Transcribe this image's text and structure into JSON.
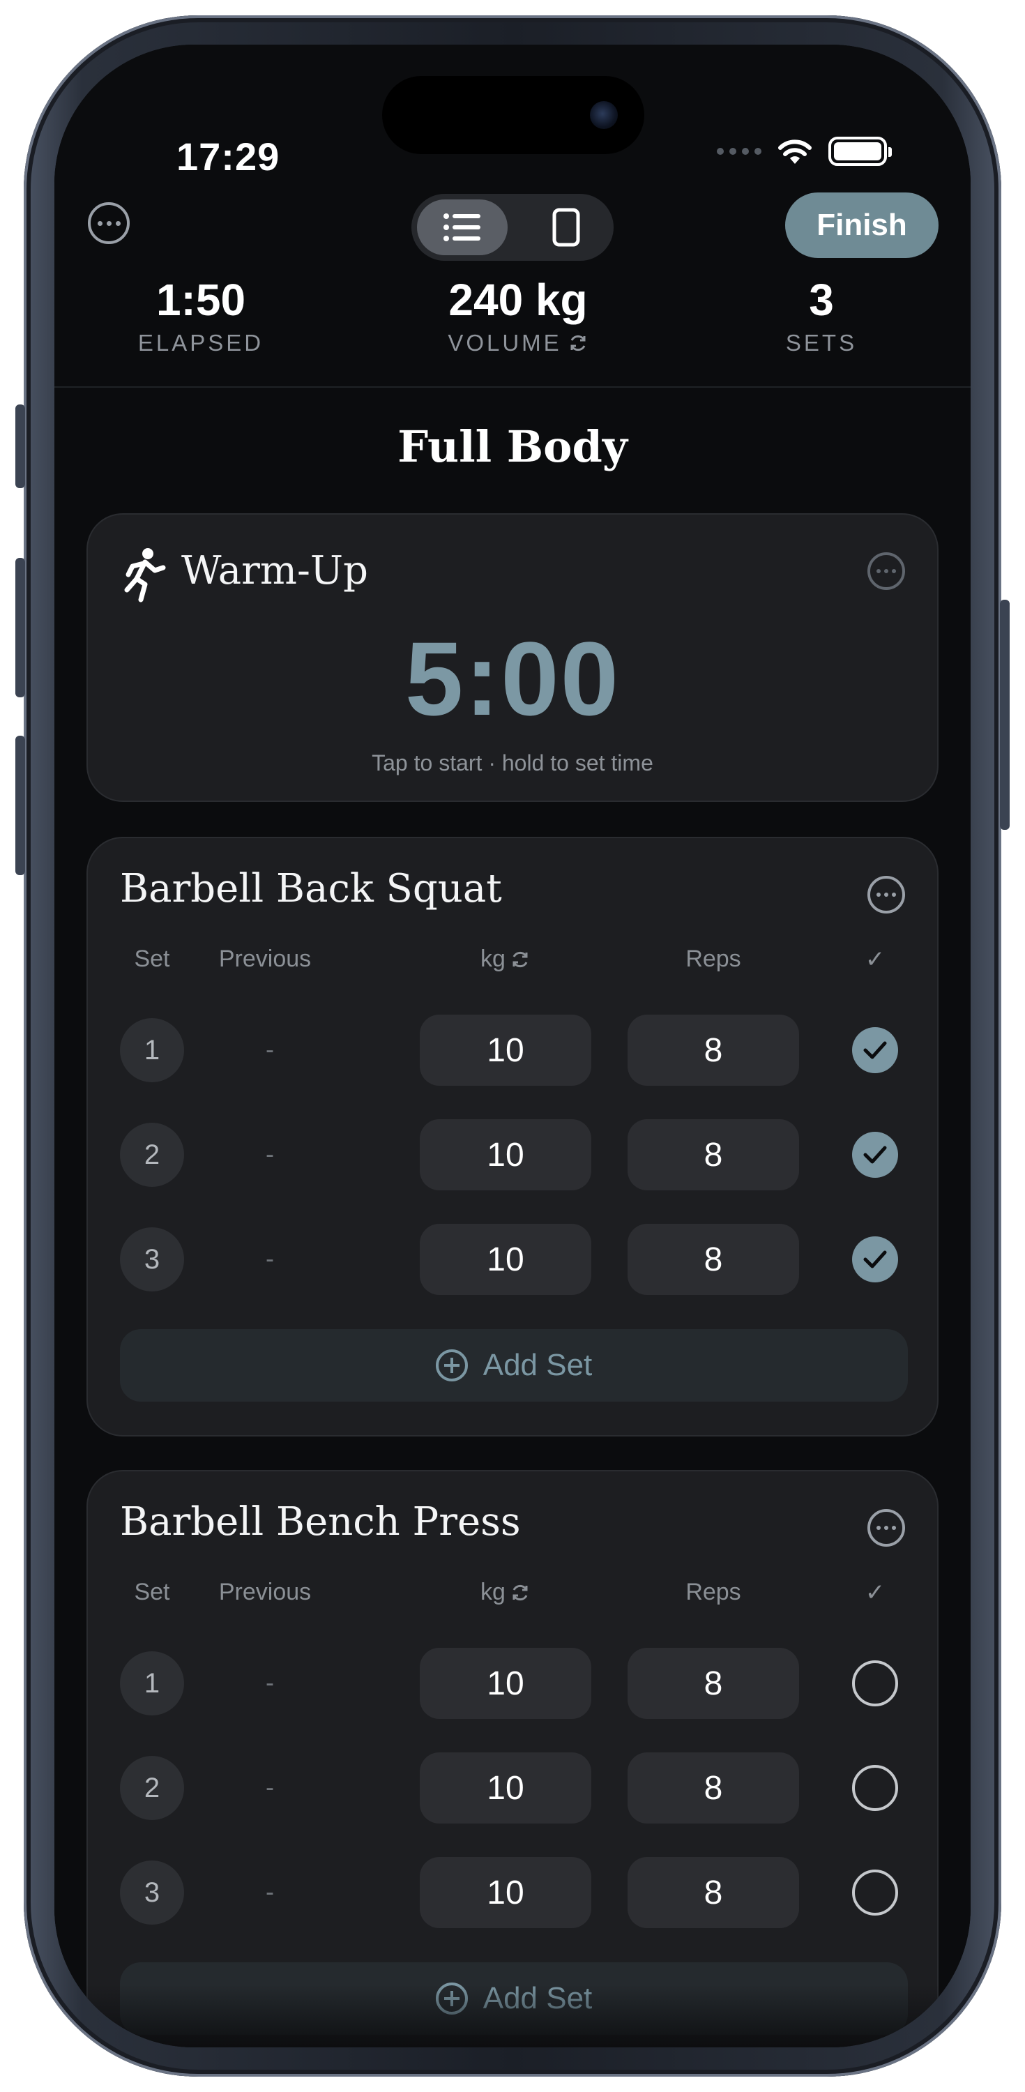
{
  "status_bar": {
    "time": "17:29"
  },
  "header": {
    "more_icon": "ellipsis-circle-icon",
    "view_toggle": {
      "list_icon": "list-icon",
      "card_icon": "card-icon",
      "selected": "list"
    },
    "finish_label": "Finish",
    "accent_color": "#6f8b95"
  },
  "stats": {
    "elapsed": {
      "value": "1:50",
      "label": "ELAPSED"
    },
    "volume": {
      "value": "240 kg",
      "label": "VOLUME"
    },
    "sets": {
      "value": "3",
      "label": "SETS"
    }
  },
  "workout": {
    "title": "Full Body"
  },
  "warmup": {
    "title": "Warm-Up",
    "timer": "5:00",
    "hint": "Tap to start · hold to set time",
    "icon": "running-figure-icon"
  },
  "columns": {
    "set": "Set",
    "previous": "Previous",
    "weight": "kg",
    "reps": "Reps",
    "check": "✓"
  },
  "exercises": [
    {
      "name": "Barbell Back Squat",
      "add_set_label": "Add Set",
      "sets": [
        {
          "number": "1",
          "previous": "-",
          "weight": "10",
          "reps": "8",
          "completed": true
        },
        {
          "number": "2",
          "previous": "-",
          "weight": "10",
          "reps": "8",
          "completed": true
        },
        {
          "number": "3",
          "previous": "-",
          "weight": "10",
          "reps": "8",
          "completed": true
        }
      ]
    },
    {
      "name": "Barbell Bench Press",
      "add_set_label": "Add Set",
      "sets": [
        {
          "number": "1",
          "previous": "-",
          "weight": "10",
          "reps": "8",
          "completed": false
        },
        {
          "number": "2",
          "previous": "-",
          "weight": "10",
          "reps": "8",
          "completed": false
        },
        {
          "number": "3",
          "previous": "-",
          "weight": "10",
          "reps": "8",
          "completed": false
        }
      ]
    }
  ],
  "colors": {
    "checked": "#7b97a3",
    "timer": "#7c98a4",
    "card_bg": "#1d1e21"
  }
}
